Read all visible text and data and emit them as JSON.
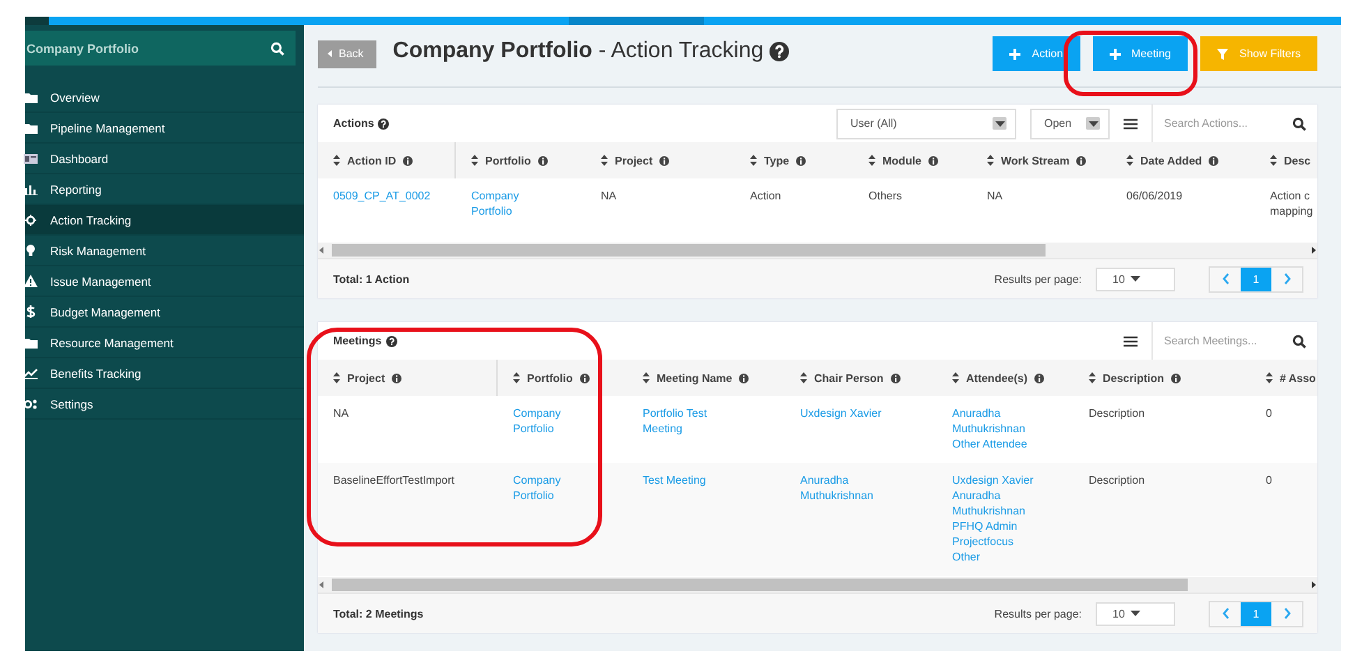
{
  "sidebar": {
    "title": "Company Portfolio",
    "items": [
      {
        "label": "Overview",
        "selected": false
      },
      {
        "label": "Pipeline Management",
        "selected": false
      },
      {
        "label": "Dashboard",
        "selected": false
      },
      {
        "label": "Reporting",
        "selected": false
      },
      {
        "label": "Action Tracking",
        "selected": true
      },
      {
        "label": "Risk Management",
        "selected": false
      },
      {
        "label": "Issue Management",
        "selected": false
      },
      {
        "label": "Budget Management",
        "selected": false
      },
      {
        "label": "Resource Management",
        "selected": false
      },
      {
        "label": "Benefits Tracking",
        "selected": false
      },
      {
        "label": "Settings",
        "selected": false
      }
    ]
  },
  "header": {
    "back": "Back",
    "title": "Company Portfolio",
    "subtitle": "- Action Tracking",
    "buttons": [
      {
        "label": "Action",
        "kind": "add"
      },
      {
        "label": "Meeting",
        "kind": "add"
      },
      {
        "label": "Show Filters",
        "kind": "filter"
      }
    ]
  },
  "actions": {
    "title": "Actions",
    "filters": [
      {
        "value": "User (All)"
      },
      {
        "value": "Open"
      }
    ],
    "search": {
      "placeholder": "Search Actions..."
    },
    "columns": [
      "Action ID",
      "Portfolio",
      "Project",
      "Type",
      "Module",
      "Work Stream",
      "Date Added",
      "Desc"
    ],
    "rows": [
      [
        {
          "lines": [
            "0509_CP_AT_0002"
          ],
          "link": true
        },
        {
          "lines": [
            "Company Portfolio"
          ],
          "link": true
        },
        {
          "lines": [
            "NA"
          ],
          "link": false
        },
        {
          "lines": [
            "Action"
          ],
          "link": false
        },
        {
          "lines": [
            "Others"
          ],
          "link": false
        },
        {
          "lines": [
            "NA"
          ],
          "link": false
        },
        {
          "lines": [
            "06/06/2019"
          ],
          "link": false
        },
        {
          "lines": [
            "Action c",
            "mapping"
          ],
          "link": false
        }
      ]
    ],
    "total": "Total: 1 Action",
    "results_label": "Results per page:",
    "per_page": "10",
    "pages": [
      {
        "label": "1",
        "selected": true
      }
    ]
  },
  "meetings": {
    "title": "Meetings",
    "search": {
      "placeholder": "Search Meetings..."
    },
    "columns": [
      "Project",
      "Portfolio",
      "Meeting Name",
      "Chair Person",
      "Attendee(s)",
      "Description",
      "# Asso"
    ],
    "rows": [
      [
        {
          "lines": [
            "NA"
          ],
          "link": false
        },
        {
          "lines": [
            "Company Portfolio"
          ],
          "link": true
        },
        {
          "lines": [
            "Portfolio Test Meeting"
          ],
          "link": true
        },
        {
          "lines": [
            "Uxdesign Xavier"
          ],
          "link": true
        },
        {
          "lines": [
            "Anuradha Muthukrishnan",
            "Other Attendee"
          ],
          "link": true
        },
        {
          "lines": [
            "Description"
          ],
          "link": false
        },
        {
          "lines": [
            "0"
          ],
          "link": false
        }
      ],
      [
        {
          "lines": [
            "BaselineEffortTestImport"
          ],
          "link": false
        },
        {
          "lines": [
            "Company Portfolio"
          ],
          "link": true
        },
        {
          "lines": [
            "Test Meeting"
          ],
          "link": true
        },
        {
          "lines": [
            "Anuradha Muthukrishnan"
          ],
          "link": true
        },
        {
          "lines": [
            "Uxdesign Xavier",
            "Anuradha Muthukrishnan",
            "PFHQ Admin",
            "Projectfocus Other"
          ],
          "link": true
        },
        {
          "lines": [
            "Description"
          ],
          "link": false
        },
        {
          "lines": [
            "0"
          ],
          "link": false
        }
      ]
    ],
    "total": "Total: 2 Meetings",
    "results_label": "Results per page:",
    "per_page": "10",
    "pages": [
      {
        "label": "1",
        "selected": true
      }
    ]
  }
}
